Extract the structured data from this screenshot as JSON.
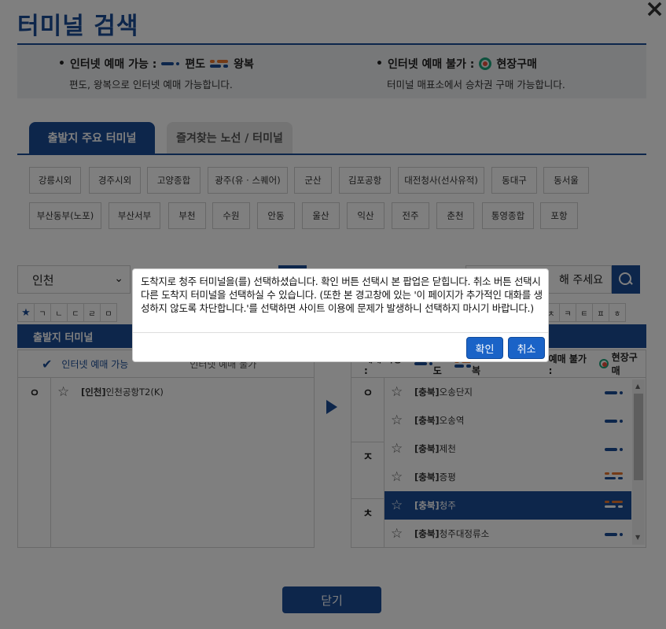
{
  "header": {
    "title": "터미널 검색",
    "close_glyph": "×"
  },
  "info": {
    "available_label": "인터넷 예매 가능 :",
    "oneway_label": "편도",
    "round_label": "왕복",
    "available_desc": "편도, 왕복으로 인터넷 예매 가능합니다.",
    "unavailable_label": "인터넷 예매 불가 :",
    "onsite_label": "현장구매",
    "unavailable_desc": "터미널 매표소에서 승차권 구매 가능합니다."
  },
  "tabs": [
    {
      "label": "출발지 주요 터미널",
      "active": true
    },
    {
      "label": "즐겨찾는 노선 / 터미널",
      "active": false
    }
  ],
  "major_terminals": [
    "강릉시외",
    "경주시외",
    "고양종합",
    "광주(유 · 스퀘어)",
    "군산",
    "김포공항",
    "대전청사(선사유적)",
    "동대구",
    "동서울",
    "부산동부(노포)",
    "부산서부",
    "부천",
    "수원",
    "안동",
    "울산",
    "익산",
    "전주",
    "춘천",
    "통영종합",
    "포항"
  ],
  "search": {
    "departure_region": "인천",
    "destination_placeholder": "해 주세요"
  },
  "consonants_left": [
    "★",
    "ㄱ",
    "ㄴ",
    "ㄷ",
    "ㄹ",
    "ㅁ"
  ],
  "consonants_right": [
    "ㅊ",
    "ㅋ",
    "ㅌ",
    "ㅍ",
    "ㅎ"
  ],
  "departure_panel": {
    "header": "출발지 터미널",
    "filter_label": "인터넷 예매 가능",
    "filter_label2": "인터넷 예매 불가",
    "groups": [
      {
        "index": "ㅇ",
        "rows": [
          {
            "region": "[인천]",
            "name": "인천공항T2(K)"
          }
        ]
      }
    ]
  },
  "arrival_panel": {
    "legend_prefix": "예매 가능 :",
    "legend_oneway": "편도",
    "legend_round": "왕복",
    "legend_unavail": "예매 불가 :",
    "legend_onsite": "현장구매",
    "index": [
      "ㅇ",
      "ㅈ",
      "ㅊ"
    ],
    "rows": [
      {
        "region": "[충북]",
        "name": "오송단지",
        "type": "oneway",
        "selected": false
      },
      {
        "region": "[충북]",
        "name": "오송역",
        "type": "oneway",
        "selected": false
      },
      {
        "region": "[충북]",
        "name": "제천",
        "type": "oneway",
        "selected": false
      },
      {
        "region": "[충북]",
        "name": "증평",
        "type": "round",
        "selected": false
      },
      {
        "region": "[충북]",
        "name": "청주",
        "type": "round",
        "selected": true
      },
      {
        "region": "[충북]",
        "name": "청주대정류소",
        "type": "oneway",
        "selected": false
      }
    ]
  },
  "footer": {
    "close_label": "닫기"
  },
  "dialog": {
    "message": "도착지로 청주 터미널을(를) 선택하셨습니다. 확인 버튼 선택시 본 팝업은 닫힙니다. 취소 버튼 선택시 다른 도착지 터미널을 선택하실 수 있습니다. (또한 본 경고창에 있는 '이 페이지가 추가적인 대화를 생성하지 않도록 차단합니다.'를 선택하면 사이트 이용에 문제가 발생하니 선택하지 마시기 바랍니다.)",
    "ok_label": "확인",
    "cancel_label": "취소"
  },
  "colors": {
    "brand": "#1a4c97",
    "round_orange": "#e8772e",
    "onsite_green": "#1aa37a"
  }
}
